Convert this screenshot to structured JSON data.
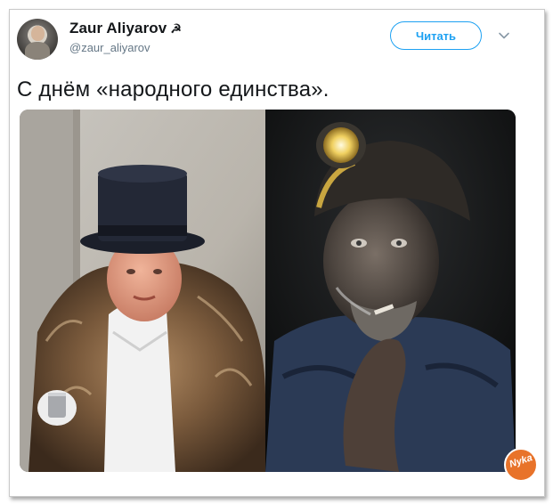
{
  "tweet": {
    "author": {
      "display_name": "Zaur Aliyarov",
      "name_emoji": "☭",
      "handle": "@zaur_aliyarov"
    },
    "follow_label": "Читать",
    "menu_icon": "chevron-down-icon",
    "text": "С днём «народного единства».",
    "media": {
      "left_photo": "man-in-top-hat-and-fur-coat",
      "right_photo": "coal-miner-smoking"
    }
  },
  "watermark": {
    "text": "Nyka",
    "color": "#e8732a"
  },
  "colors": {
    "accent": "#1da1f2",
    "text": "#14171a",
    "secondary": "#657786"
  }
}
